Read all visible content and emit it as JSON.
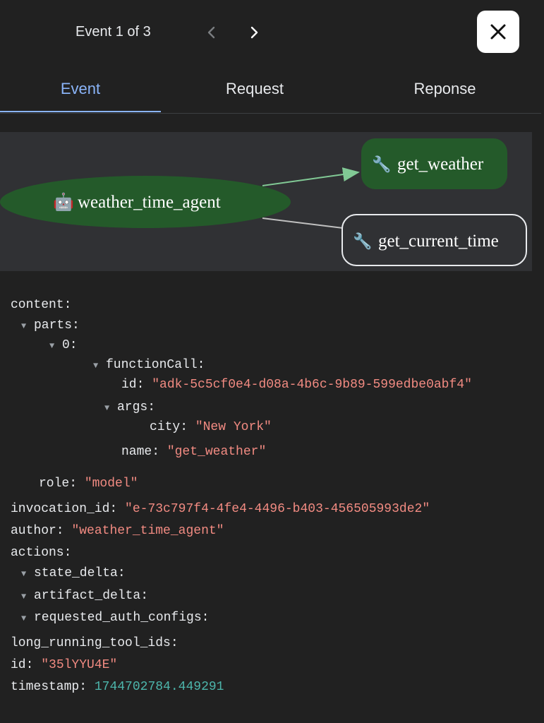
{
  "header": {
    "event_counter": "Event 1 of 3",
    "prev_icon": "chevron-left-icon",
    "next_icon": "chevron-right-icon",
    "close_icon": "close-icon"
  },
  "tabs": [
    {
      "label": "Event",
      "active": true
    },
    {
      "label": "Request",
      "active": false
    },
    {
      "label": "Reponse",
      "active": false
    }
  ],
  "graph": {
    "agent_node": {
      "icon": "🤖",
      "label": "weather_time_agent"
    },
    "tool_nodes": [
      {
        "icon": "🔧",
        "label": "get_weather",
        "active": true
      },
      {
        "icon": "🔧",
        "label": "get_current_time",
        "active": false
      }
    ],
    "colors": {
      "active_fill": "#245a2a",
      "active_edge": "#81c995",
      "edge": "#c0c0c0",
      "background": "#303134"
    }
  },
  "event": {
    "content_key": "content:",
    "parts_key": "parts:",
    "index_key": "0:",
    "function_call_key": "functionCall:",
    "fc_id_key": "id:",
    "fc_id_value": "\"adk-5c5cf0e4-d08a-4b6c-9b89-599edbe0abf4\"",
    "args_key": "args:",
    "city_key": "city:",
    "city_value": "\"New York\"",
    "name_key": "name:",
    "name_value": "\"get_weather\"",
    "role_key": "role:",
    "role_value": "\"model\"",
    "invocation_id_key": "invocation_id:",
    "invocation_id_value": "\"e-73c797f4-4fe4-4496-b403-456505993de2\"",
    "author_key": "author:",
    "author_value": "\"weather_time_agent\"",
    "actions_key": "actions:",
    "state_delta_key": "state_delta:",
    "artifact_delta_key": "artifact_delta:",
    "requested_auth_configs_key": "requested_auth_configs:",
    "long_running_tool_ids_key": "long_running_tool_ids:",
    "id_key": "id:",
    "id_value": "\"35lYYU4E\"",
    "timestamp_key": "timestamp:",
    "timestamp_value": "1744702784.449291",
    "toggle_glyph": "▼"
  }
}
